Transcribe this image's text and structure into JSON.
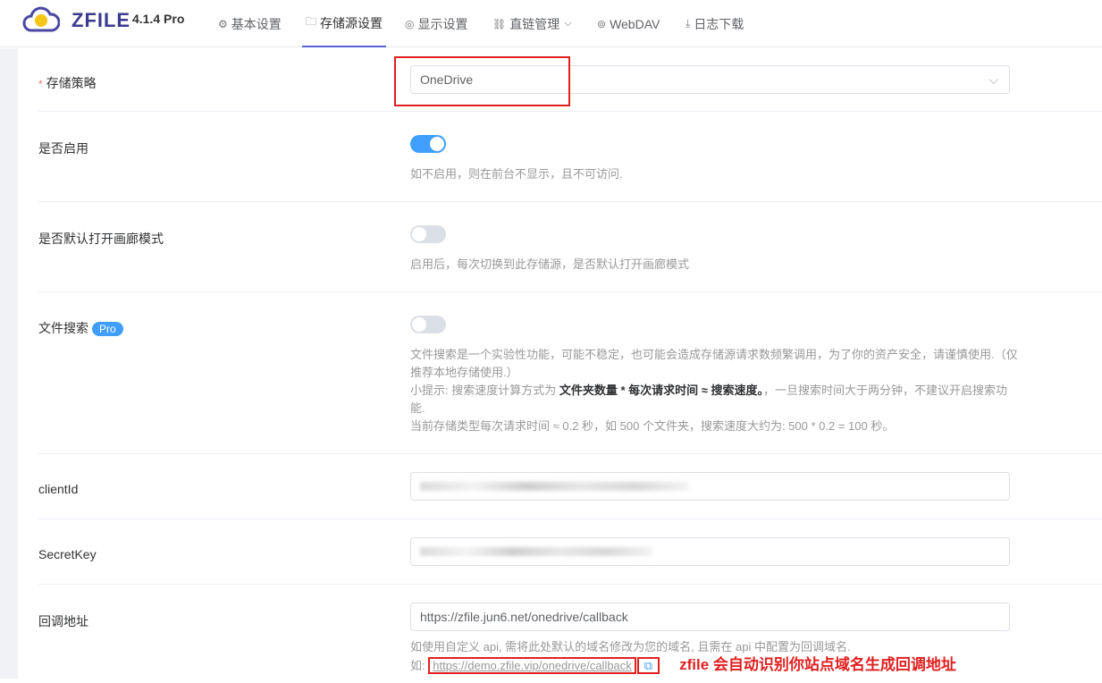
{
  "header": {
    "brand": "ZFILE",
    "version": "4.1.4 Pro",
    "nav": [
      {
        "icon": "gear-icon",
        "glyph": "⚙",
        "label": "基本设置"
      },
      {
        "icon": "folder-icon",
        "glyph": "🗀",
        "label": "存储源设置"
      },
      {
        "icon": "eye-icon",
        "glyph": "◎",
        "label": "显示设置"
      },
      {
        "icon": "link-icon",
        "glyph": "⛓",
        "label": "直链管理"
      },
      {
        "icon": "webdav-icon",
        "glyph": "⊚",
        "label": "WebDAV"
      },
      {
        "icon": "download-icon",
        "glyph": "⤓",
        "label": "日志下载"
      }
    ]
  },
  "form": {
    "storage": {
      "label": "存储策略",
      "value": "OneDrive"
    },
    "enable": {
      "label": "是否启用",
      "on": true,
      "help": "如不启用，则在前台不显示，且不可访问."
    },
    "gallery": {
      "label": "是否默认打开画廊模式",
      "on": false,
      "help": "启用后，每次切换到此存储源，是否默认打开画廊模式"
    },
    "search": {
      "label": "文件搜索",
      "badge": "Pro",
      "on": false,
      "help1": "文件搜索是一个实验性功能，可能不稳定，也可能会造成存储源请求数频繁调用，为了你的资产安全，请谨慎使用.（仅推荐本地存储使用.）",
      "help2a": "小提示: 搜索速度计算方式为 ",
      "help2b": "文件夹数量 * 每次请求时间 ≈ 搜索速度。",
      "help2c": "，一旦搜索时间大于两分钟，不建议开启搜索功能.",
      "help3": "当前存储类型每次请求时间 ≈ 0.2 秒，如 500 个文件夹，搜索速度大约为: 500 * 0.2 = 100 秒。"
    },
    "clientId": {
      "label": "clientId"
    },
    "secretKey": {
      "label": "SecretKey"
    },
    "callback": {
      "label": "回调地址",
      "value": "https://zfile.jun6.net/onedrive/callback",
      "help": "如使用自定义 api, 需将此处默认的域名修改为您的域名, 且需在 api 中配置为回调域名.",
      "example_prefix": "如: ",
      "example": "https://demo.zfile.vip/onedrive/callback"
    }
  },
  "annotation": "zfile 会自动识别你站点域名生成回调地址",
  "colors": {
    "primary": "#409eff",
    "annotation": "#e02020"
  }
}
